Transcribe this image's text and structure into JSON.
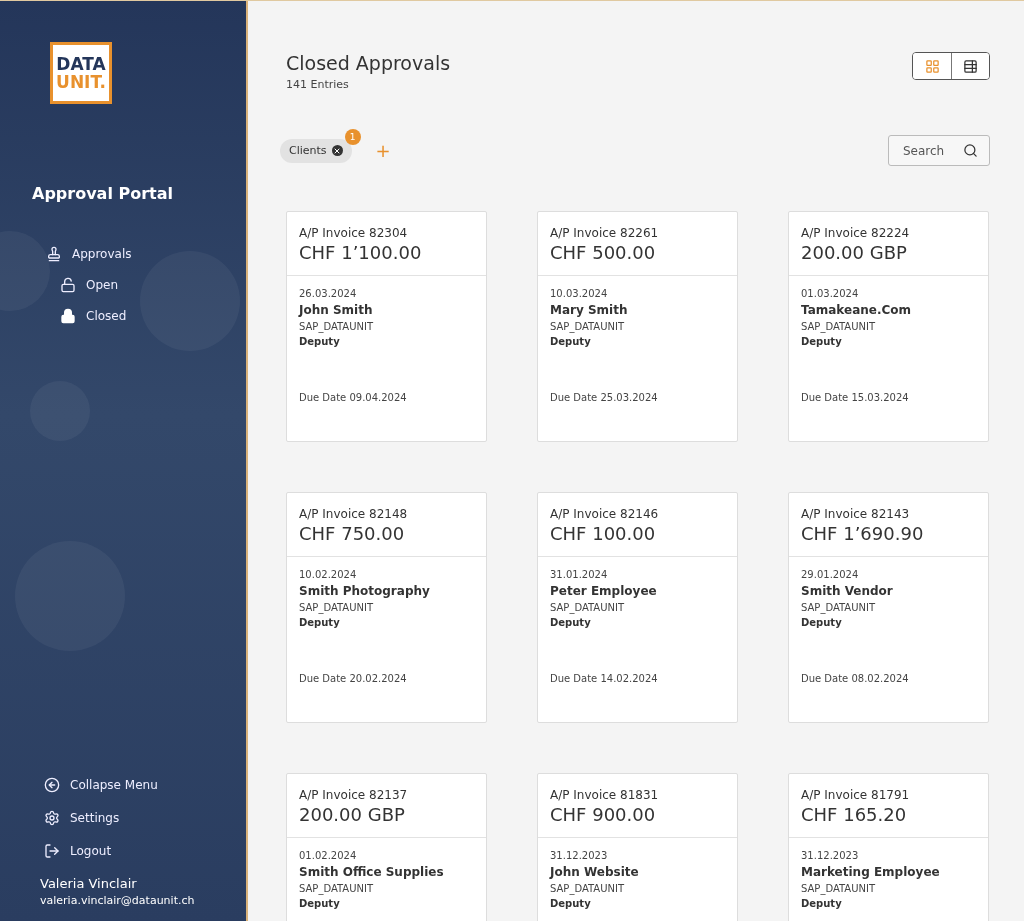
{
  "sidebar": {
    "logo": {
      "line1": "DATA",
      "line2": "UNIT."
    },
    "title": "Approval Portal",
    "nav": [
      {
        "label": "Approvals",
        "kind": "stamp",
        "children": [
          {
            "label": "Open",
            "kind": "unlocked"
          },
          {
            "label": "Closed",
            "kind": "locked"
          }
        ]
      }
    ],
    "footer_items": [
      {
        "label": "Collapse Menu",
        "kind": "collapse"
      },
      {
        "label": "Settings",
        "kind": "settings"
      },
      {
        "label": "Logout",
        "kind": "logout"
      }
    ],
    "user": {
      "name": "Valeria Vinclair",
      "email": "valeria.vinclair@dataunit.ch"
    }
  },
  "header": {
    "title": "Closed Approvals",
    "count": "141 Entries",
    "view_toggle": [
      {
        "kind": "grid",
        "selected": true
      },
      {
        "kind": "list",
        "selected": false
      }
    ]
  },
  "filters": {
    "chips": [
      {
        "label": "Clients",
        "badge": "1"
      }
    ],
    "add": "+",
    "search": {
      "placeholder": "Search"
    }
  },
  "cards": [
    {
      "title": "A/P Invoice 82304",
      "amount": "CHF 1’100.00",
      "date": "26.03.2024",
      "name": "John Smith",
      "company": "SAP_DATAUNIT",
      "role": "Deputy",
      "due": "Due Date 09.04.2024"
    },
    {
      "title": "A/P Invoice 82261",
      "amount": "CHF 500.00",
      "date": "10.03.2024",
      "name": "Mary Smith",
      "company": "SAP_DATAUNIT",
      "role": "Deputy",
      "due": "Due Date 25.03.2024"
    },
    {
      "title": "A/P Invoice 82224",
      "amount": "200.00 GBP",
      "date": "01.03.2024",
      "name": "Tamakeane.Com",
      "company": "SAP_DATAUNIT",
      "role": "Deputy",
      "due": "Due Date 15.03.2024"
    },
    {
      "title": "A/P Invoice 82148",
      "amount": "CHF 750.00",
      "date": "10.02.2024",
      "name": "Smith Photography",
      "company": "SAP_DATAUNIT",
      "role": "Deputy",
      "due": "Due Date 20.02.2024"
    },
    {
      "title": "A/P Invoice 82146",
      "amount": "CHF 100.00",
      "date": "31.01.2024",
      "name": "Peter Employee",
      "company": "SAP_DATAUNIT",
      "role": "Deputy",
      "due": "Due Date 14.02.2024"
    },
    {
      "title": "A/P Invoice 82143",
      "amount": "CHF 1’690.90",
      "date": "29.01.2024",
      "name": "Smith Vendor",
      "company": "SAP_DATAUNIT",
      "role": "Deputy",
      "due": "Due Date 08.02.2024"
    },
    {
      "title": "A/P Invoice 82137",
      "amount": "200.00 GBP",
      "date": "01.02.2024",
      "name": "Smith Office Supplies",
      "company": "SAP_DATAUNIT",
      "role": "Deputy"
    },
    {
      "title": "A/P Invoice 81831",
      "amount": "CHF 900.00",
      "date": "31.12.2023",
      "name": "John Website",
      "company": "SAP_DATAUNIT",
      "role": "Deputy"
    },
    {
      "title": "A/P Invoice 81791",
      "amount": "CHF 165.20",
      "date": "31.12.2023",
      "name": "Marketing Employee",
      "company": "SAP_DATAUNIT",
      "role": "Deputy"
    }
  ]
}
